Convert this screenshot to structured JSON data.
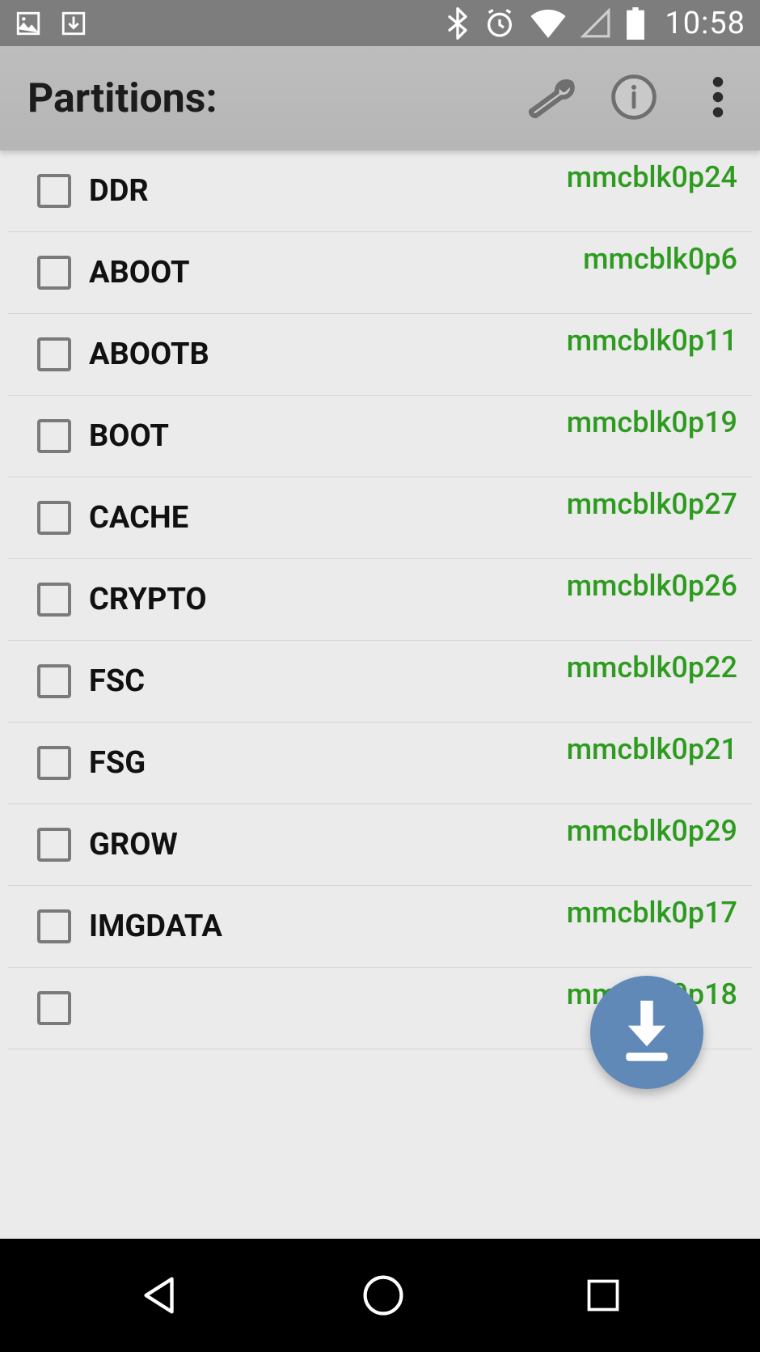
{
  "statusbar": {
    "clock": "10:58"
  },
  "header": {
    "title": "Partitions:"
  },
  "partitions": [
    {
      "name": "DDR",
      "device": "mmcblk0p24"
    },
    {
      "name": "ABOOT",
      "device": "mmcblk0p6"
    },
    {
      "name": "ABOOTB",
      "device": "mmcblk0p11"
    },
    {
      "name": "BOOT",
      "device": "mmcblk0p19"
    },
    {
      "name": "CACHE",
      "device": "mmcblk0p27"
    },
    {
      "name": "CRYPTO",
      "device": "mmcblk0p26"
    },
    {
      "name": "FSC",
      "device": "mmcblk0p22"
    },
    {
      "name": "FSG",
      "device": "mmcblk0p21"
    },
    {
      "name": "GROW",
      "device": "mmcblk0p29"
    },
    {
      "name": "IMGDATA",
      "device": "mmcblk0p17"
    },
    {
      "name": "",
      "device": "mmcblk0p18"
    }
  ]
}
